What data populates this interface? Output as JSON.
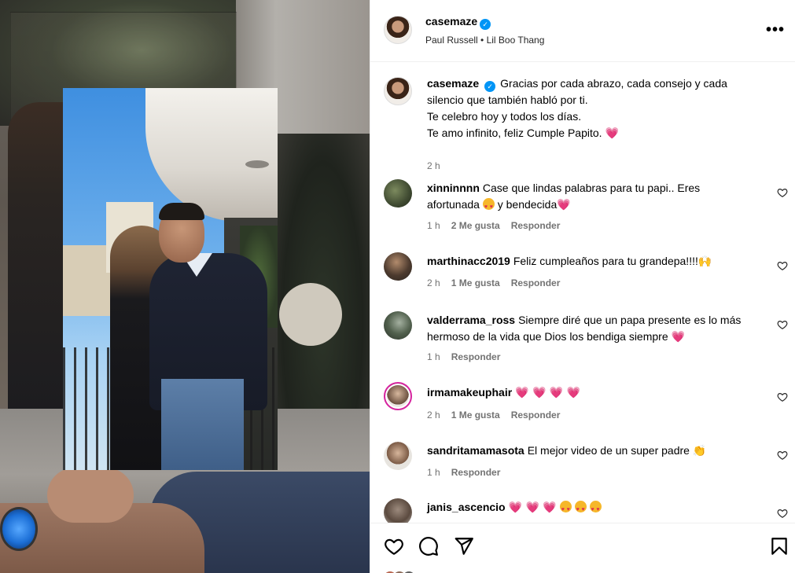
{
  "post": {
    "username": "casemaze",
    "audio": "Paul Russell • Lil Boo Thang",
    "caption_lines": [
      "Gracias por cada abrazo, cada consejo y cada",
      "silencio que también habló por ti.",
      "Te celebro hoy y todos los días.",
      "Te amo infinito, feliz Cumple Papito."
    ],
    "caption_emoji": "💗",
    "time": "2 h"
  },
  "comments": [
    {
      "username": "xinninnnn",
      "text_a": "Case que lindas palabras para tu papi.. Eres",
      "text_b1": "afortunada",
      "text_b2": "y bendecida",
      "time": "1 h",
      "likes": "2 Me gusta",
      "reply": "Responder"
    },
    {
      "username": "marthinacc2019",
      "text": "Feliz cumpleaños para tu grandepa!!!!",
      "emoji": "🙌",
      "time": "2 h",
      "likes": "1 Me gusta",
      "reply": "Responder"
    },
    {
      "username": "valderrama_ross",
      "text_a": "Siempre diré que un papa presente es lo más",
      "text_b": "hermoso de la vida que Dios los bendiga siempre",
      "time": "1 h",
      "reply": "Responder"
    },
    {
      "username": "irmamakeuphair",
      "text": "💗 💗 💗 💗",
      "time": "2 h",
      "likes": "1 Me gusta",
      "reply": "Responder"
    },
    {
      "username": "sandritamamasota",
      "text": "El mejor video de un super padre",
      "emoji": "👏",
      "time": "1 h",
      "reply": "Responder"
    },
    {
      "username": "janis_ascencio",
      "text": "💗 💗 💗"
    }
  ],
  "icons": {
    "like": "heart-icon",
    "comment": "comment-icon",
    "share": "send-icon",
    "save": "bookmark-icon",
    "more": "more-options-icon"
  },
  "colors": {
    "verified": "#0095f6",
    "heart_emoji": "#e8365d",
    "meta_text": "#737373"
  }
}
